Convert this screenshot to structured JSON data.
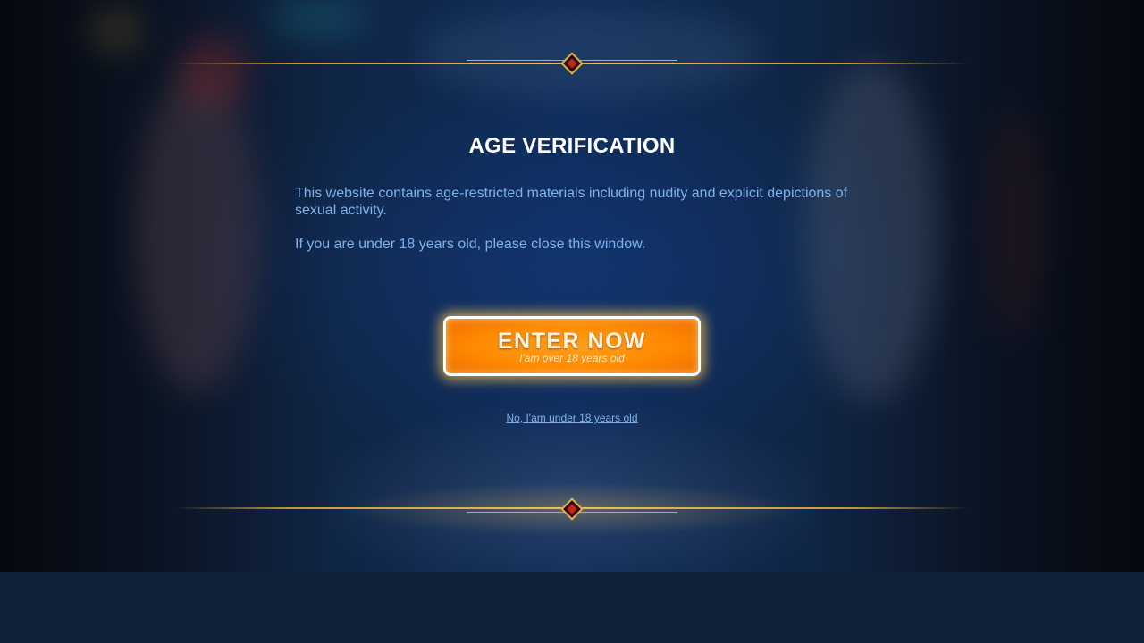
{
  "modal": {
    "title": "AGE VERIFICATION",
    "message_1": "This website contains age-restricted materials including nudity and explicit depictions of sexual activity.",
    "message_2": "If you are under 18 years old, please close this window."
  },
  "enter_button": {
    "label": "ENTER NOW",
    "sublabel": "I'am over 18 years old"
  },
  "decline_link": {
    "label": "No, I'am under 18 years old"
  },
  "colors": {
    "accent_orange": "#ff8a00",
    "text_blue": "#7fb2ec",
    "gold_frame": "#e7b24c",
    "footer_band": "#102038"
  },
  "icons": {
    "frame_gem": "diamond-gem-icon"
  }
}
